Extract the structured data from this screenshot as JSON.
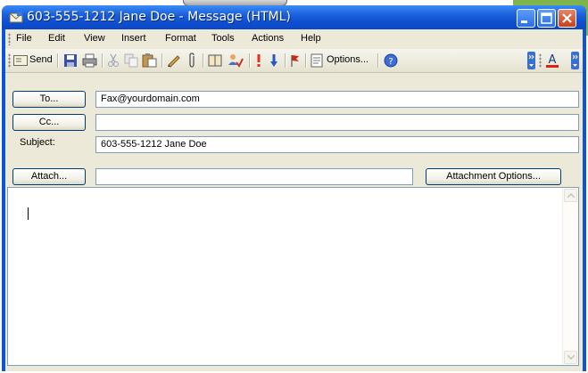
{
  "window": {
    "title": "603-555-1212 Jane Doe - Message (HTML)"
  },
  "menu": {
    "file": "File",
    "edit": "Edit",
    "view": "View",
    "insert": "Insert",
    "format": "Format",
    "tools": "Tools",
    "actions": "Actions",
    "help": "Help"
  },
  "toolbar": {
    "send_label": "Send",
    "options_label": "Options...",
    "icons": [
      "envelope-icon",
      "save-icon",
      "print-icon",
      "cut-icon",
      "copy-icon",
      "paste-icon",
      "signature-icon",
      "attach-icon",
      "address-book-icon",
      "check-names-icon",
      "importance-high-icon",
      "importance-low-icon",
      "follow-up-flag-icon",
      "options-icon",
      "help-icon",
      "font-color-icon"
    ]
  },
  "form": {
    "to_label": "To...",
    "to_value": "Fax@yourdomain.com",
    "cc_label": "Cc...",
    "cc_value": "",
    "subject_label": "Subject:",
    "subject_value": "603-555-1212 Jane Doe",
    "attach_label": "Attach...",
    "attach_value": "",
    "attachment_options_label": "Attachment Options..."
  },
  "colors": {
    "titlebar": "#0b48c4",
    "close_button": "#c8401c",
    "dialog_background": "#ece9d8",
    "field_border": "#7f9db9",
    "button_border": "#003c74"
  }
}
